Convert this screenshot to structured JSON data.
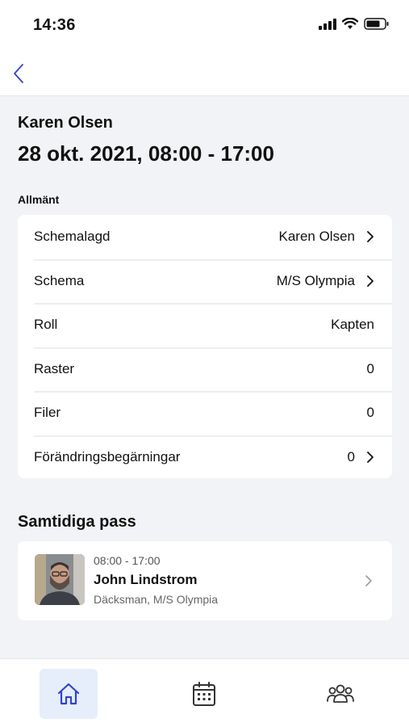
{
  "status_bar": {
    "time": "14:36",
    "icons": [
      "signal-icon",
      "wifi-icon",
      "battery-icon"
    ]
  },
  "nav": {
    "back_icon": "chevron-left-icon"
  },
  "header": {
    "person_name": "Karen Olsen",
    "datetime": "28 okt. 2021, 08:00 - 17:00"
  },
  "general": {
    "section_label": "Allmänt",
    "rows": [
      {
        "label": "Schemalagd",
        "value": "Karen Olsen",
        "has_chevron": true
      },
      {
        "label": "Schema",
        "value": "M/S Olympia",
        "has_chevron": true
      },
      {
        "label": "Roll",
        "value": "Kapten",
        "has_chevron": false
      },
      {
        "label": "Raster",
        "value": "0",
        "has_chevron": false
      },
      {
        "label": "Filer",
        "value": "0",
        "has_chevron": false
      },
      {
        "label": "Förändringsbegärningar",
        "value": "0",
        "has_chevron": true
      }
    ]
  },
  "concurrent": {
    "title": "Samtidiga pass",
    "shifts": [
      {
        "time": "08:00 - 17:00",
        "name": "John Lindstrom",
        "role": "Däcksman, M/S Olympia"
      }
    ]
  },
  "tab_bar": {
    "tabs": [
      {
        "icon": "home-icon",
        "active": true
      },
      {
        "icon": "calendar-icon",
        "active": false
      },
      {
        "icon": "people-icon",
        "active": false
      }
    ]
  },
  "colors": {
    "accent": "#2f45c9",
    "background": "#f2f3f6",
    "active_tab_bg": "#e6eefb"
  }
}
